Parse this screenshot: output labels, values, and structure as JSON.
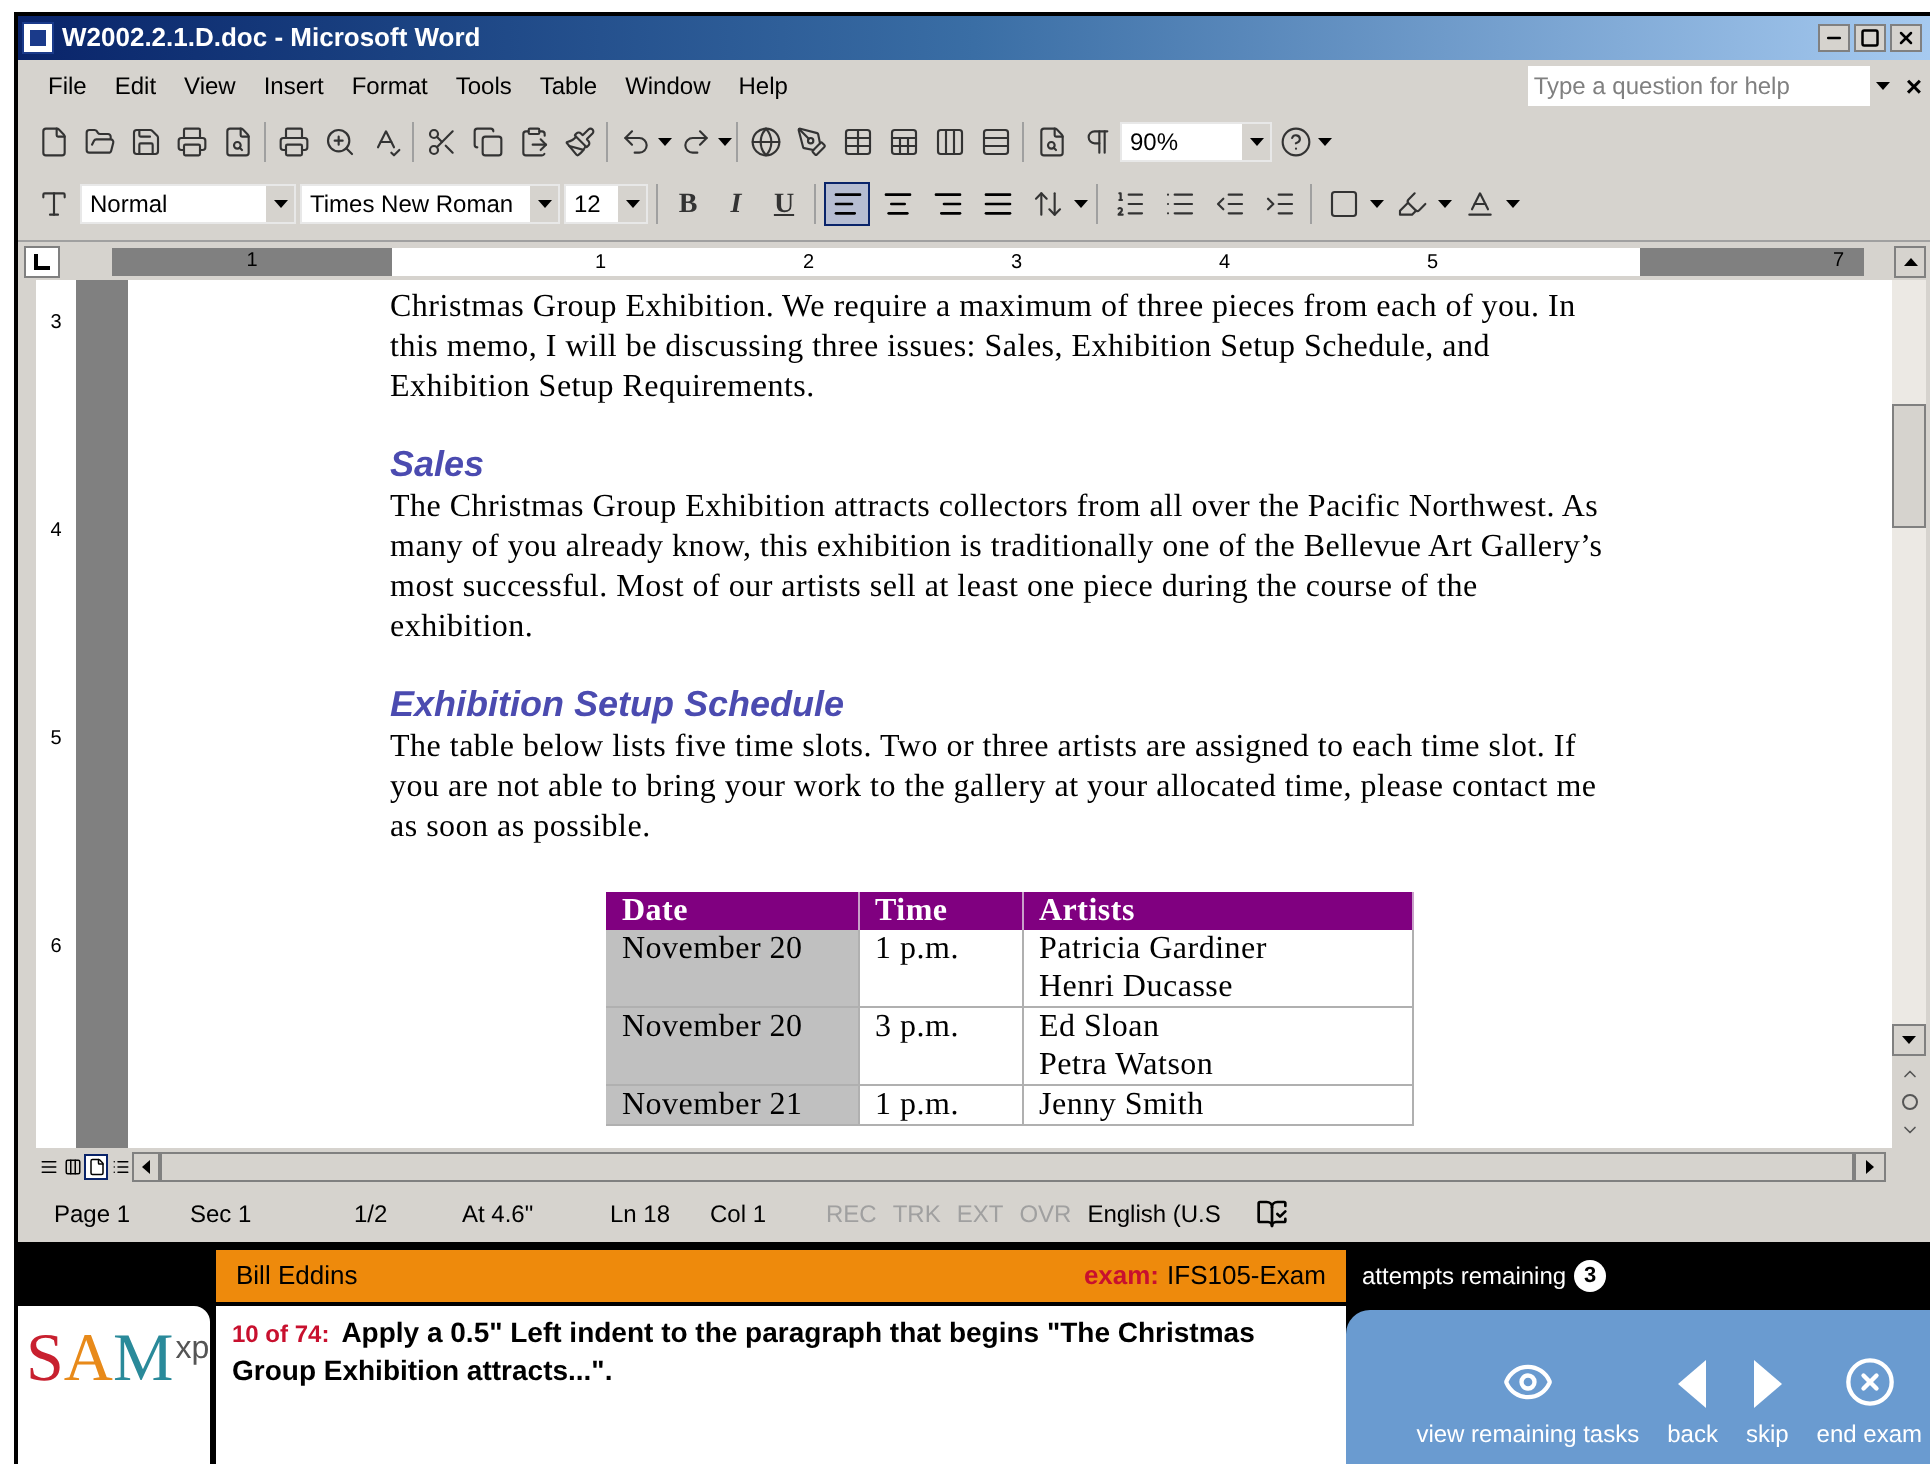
{
  "window": {
    "title": "W2002.2.1.D.doc - Microsoft Word"
  },
  "menu": [
    "File",
    "Edit",
    "View",
    "Insert",
    "Format",
    "Tools",
    "Table",
    "Window",
    "Help"
  ],
  "help_field": {
    "placeholder": "Type a question for help"
  },
  "close_doc": "×",
  "zoom_box": {
    "value": "90%"
  },
  "style_box": {
    "value": "Normal"
  },
  "font_box": {
    "value": "Times New Roman"
  },
  "size_box": {
    "value": "12"
  },
  "format_buttons": [
    "B",
    "I",
    "U"
  ],
  "alignment_buttons": [
    {
      "selected": true
    },
    {
      "selected": false
    },
    {
      "selected": false
    },
    {
      "selected": false
    }
  ],
  "ruler": {
    "horizontal": [
      "1",
      "1",
      "2",
      "3",
      "4",
      "5",
      "7"
    ],
    "vertical": [
      "3",
      "4",
      "5",
      "6"
    ]
  },
  "document": [
    {
      "kind": "paragraph",
      "text": "Christmas Group Exhibition. We require a maximum of three pieces from each of you. In this memo, I will be discussing three issues: Sales, Exhibition Setup Schedule, and Exhibition Setup Requirements."
    },
    {
      "kind": "heading",
      "text": "Sales"
    },
    {
      "kind": "paragraph",
      "text": "The Christmas Group Exhibition attracts collectors from all over the Pacific Northwest. As many of you already know, this exhibition is traditionally one of the Bellevue Art Gallery’s most successful. Most of our artists sell at least one piece during the course of the exhibition."
    },
    {
      "kind": "heading",
      "text": "Exhibition Setup Schedule"
    },
    {
      "kind": "paragraph",
      "text": "The table below lists five time slots. Two or three artists are assigned to each time slot. If you are not able to bring your work to the gallery at your allocated time, please contact me as soon as possible."
    }
  ],
  "table": {
    "columns": [
      "Date",
      "Time",
      "Artists"
    ],
    "rows": [
      [
        "November 20",
        "1 p.m.",
        [
          "Patricia Gardiner",
          "Henri Ducasse"
        ]
      ],
      [
        "November 20",
        "3 p.m.",
        [
          "Ed Sloan",
          "Petra Watson"
        ]
      ],
      [
        "November 21",
        "1 p.m.",
        [
          "Jenny Smith"
        ]
      ]
    ]
  },
  "view_buttons": [
    {
      "selected": false
    },
    {
      "selected": false
    },
    {
      "selected": true
    },
    {
      "selected": false
    }
  ],
  "status_bar": [
    {
      "text": "Page 1",
      "disabled": false
    },
    {
      "text": "Sec 1",
      "disabled": false
    },
    {
      "text": "1/2",
      "disabled": false
    },
    {
      "text": "At 4.6\"",
      "disabled": false
    },
    {
      "text": "Ln 18",
      "disabled": false
    },
    {
      "text": "Col 1",
      "disabled": false
    },
    {
      "text": "REC",
      "disabled": true
    },
    {
      "text": "TRK",
      "disabled": true
    },
    {
      "text": "EXT",
      "disabled": true
    },
    {
      "text": "OVR",
      "disabled": true
    },
    {
      "text": "English (U.S",
      "disabled": false
    }
  ],
  "exam_bar": {
    "user": "Bill Eddins",
    "exam_label": "exam:",
    "exam_name": "IFS105-Exam",
    "attempts_label": "attempts remaining",
    "attempts": "3"
  },
  "logo": {
    "letters": [
      {
        "text": "S",
        "color": "#c8202f"
      },
      {
        "text": "A",
        "color": "#e88a1a"
      },
      {
        "text": "M",
        "color": "#2a8a9a"
      }
    ],
    "suffix": "xp"
  },
  "task": {
    "counter": "10 of 74:",
    "text": "Apply a 0.5\" Left indent to the paragraph that begins \"The Christmas Group Exhibition attracts...\"."
  },
  "actions": [
    {
      "kind": "eye",
      "label": "view remaining tasks"
    },
    {
      "kind": "back",
      "label": "back"
    },
    {
      "kind": "skip",
      "label": "skip"
    },
    {
      "kind": "end",
      "label": "end exam"
    }
  ]
}
